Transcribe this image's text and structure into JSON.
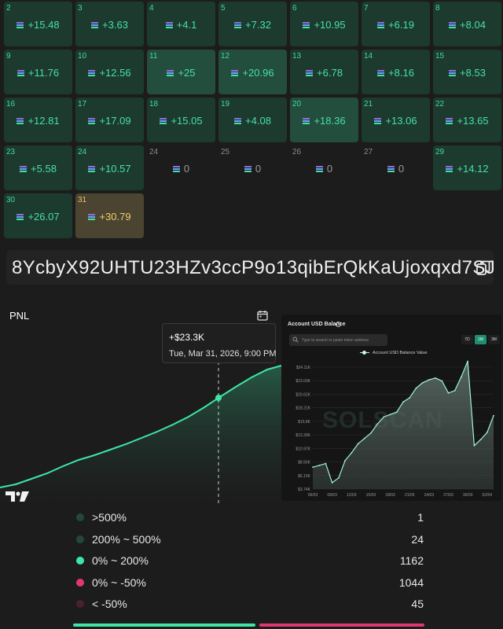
{
  "calendar": {
    "cells": [
      {
        "day": "2",
        "value": "+15.48",
        "kind": "pos"
      },
      {
        "day": "3",
        "value": "+3.63",
        "kind": "pos"
      },
      {
        "day": "4",
        "value": "+4.1",
        "kind": "pos"
      },
      {
        "day": "5",
        "value": "+7.32",
        "kind": "pos"
      },
      {
        "day": "6",
        "value": "+10.95",
        "kind": "pos"
      },
      {
        "day": "7",
        "value": "+6.19",
        "kind": "pos"
      },
      {
        "day": "8",
        "value": "+8.04",
        "kind": "pos"
      },
      {
        "day": "9",
        "value": "+11.76",
        "kind": "pos"
      },
      {
        "day": "10",
        "value": "+12.56",
        "kind": "pos"
      },
      {
        "day": "11",
        "value": "+25",
        "kind": "hi"
      },
      {
        "day": "12",
        "value": "+20.96",
        "kind": "hi"
      },
      {
        "day": "13",
        "value": "+6.78",
        "kind": "pos"
      },
      {
        "day": "14",
        "value": "+8.16",
        "kind": "pos"
      },
      {
        "day": "15",
        "value": "+8.53",
        "kind": "pos"
      },
      {
        "day": "16",
        "value": "+12.81",
        "kind": "pos"
      },
      {
        "day": "17",
        "value": "+17.09",
        "kind": "pos"
      },
      {
        "day": "18",
        "value": "+15.05",
        "kind": "pos"
      },
      {
        "day": "19",
        "value": "+4.08",
        "kind": "pos"
      },
      {
        "day": "20",
        "value": "+18.36",
        "kind": "hi"
      },
      {
        "day": "21",
        "value": "+13.06",
        "kind": "pos"
      },
      {
        "day": "22",
        "value": "+13.65",
        "kind": "pos"
      },
      {
        "day": "23",
        "value": "+5.58",
        "kind": "pos"
      },
      {
        "day": "24",
        "value": "+10.57",
        "kind": "pos"
      },
      {
        "day": "24",
        "value": "0",
        "kind": "zero"
      },
      {
        "day": "25",
        "value": "0",
        "kind": "zero"
      },
      {
        "day": "26",
        "value": "0",
        "kind": "zero"
      },
      {
        "day": "27",
        "value": "0",
        "kind": "zero"
      },
      {
        "day": "29",
        "value": "+14.12",
        "kind": "pos"
      },
      {
        "day": "30",
        "value": "+26.07",
        "kind": "pos"
      },
      {
        "day": "31",
        "value": "+30.79",
        "kind": "today"
      }
    ]
  },
  "wallet": {
    "address": "8YcbyX92UHTU23HZv3ccP9o13qibErQkKaUjoxqxd7SJ",
    "copy_icon": "copy-icon"
  },
  "pnl": {
    "title": "PNL",
    "tooltip_value": "+$23.3K",
    "tooltip_date": "Tue, Mar 31, 2026, 9:00 PM",
    "line_color": "#3ee6a6"
  },
  "balance": {
    "title": "Account USD Balance",
    "search_placeholder": "Type to search or paste token address",
    "ranges": [
      "7D",
      "1M",
      "3M"
    ],
    "active_range": "1M",
    "legend": "Account USD Balance Value",
    "watermark": "SOLSCAN"
  },
  "chart_data": {
    "type": "area",
    "title": "Account USD Balance",
    "series": [
      {
        "name": "Account USD Balance Value",
        "x": [
          "06/03",
          "07/03",
          "08/03",
          "09/03",
          "10/03",
          "11/03",
          "12/03",
          "13/03",
          "14/03",
          "15/03",
          "16/03",
          "17/03",
          "18/03",
          "19/03",
          "20/03",
          "21/03",
          "22/03",
          "23/03",
          "24/03",
          "25/03",
          "26/03",
          "27/03",
          "28/03",
          "29/03",
          "30/03",
          "31/03",
          "01/04",
          "02/04",
          "03/04"
        ],
        "values": [
          7400,
          7700,
          8000,
          4800,
          5600,
          8500,
          9800,
          11300,
          12200,
          13100,
          14600,
          15800,
          16200,
          16600,
          18300,
          19000,
          20600,
          21500,
          22000,
          22300,
          21800,
          19800,
          20200,
          22500,
          25100,
          11000,
          12000,
          13200,
          16000
        ]
      }
    ],
    "x_ticks": [
      "06/03",
      "09/03",
      "12/03",
      "15/03",
      "18/03",
      "21/03",
      "24/03",
      "27/03",
      "30/03",
      "02/04"
    ],
    "y_ticks": [
      "$3.74K",
      "$6.15K",
      "$8.56K",
      "$10.97K",
      "$13.39K",
      "$15.8K",
      "$18.21K",
      "$20.62K",
      "$23.03K",
      "$24.11K"
    ],
    "ylim": [
      3740,
      24110
    ],
    "grid": true,
    "legend_position": "top-center"
  },
  "distribution": {
    "rows": [
      {
        "label": ">500%",
        "count": "1",
        "color": "#1f4a3b"
      },
      {
        "label": "200% ~ 500%",
        "count": "24",
        "color": "#1f4a3b"
      },
      {
        "label": "0% ~ 200%",
        "count": "1162",
        "color": "#3ee6a6"
      },
      {
        "label": "0% ~ -50%",
        "count": "1044",
        "color": "#e0386e"
      },
      {
        "label": "< -50%",
        "count": "45",
        "color": "#4a2030"
      }
    ],
    "bar_colors": {
      "gain": "#3ee6a6",
      "loss": "#e0386e"
    }
  }
}
